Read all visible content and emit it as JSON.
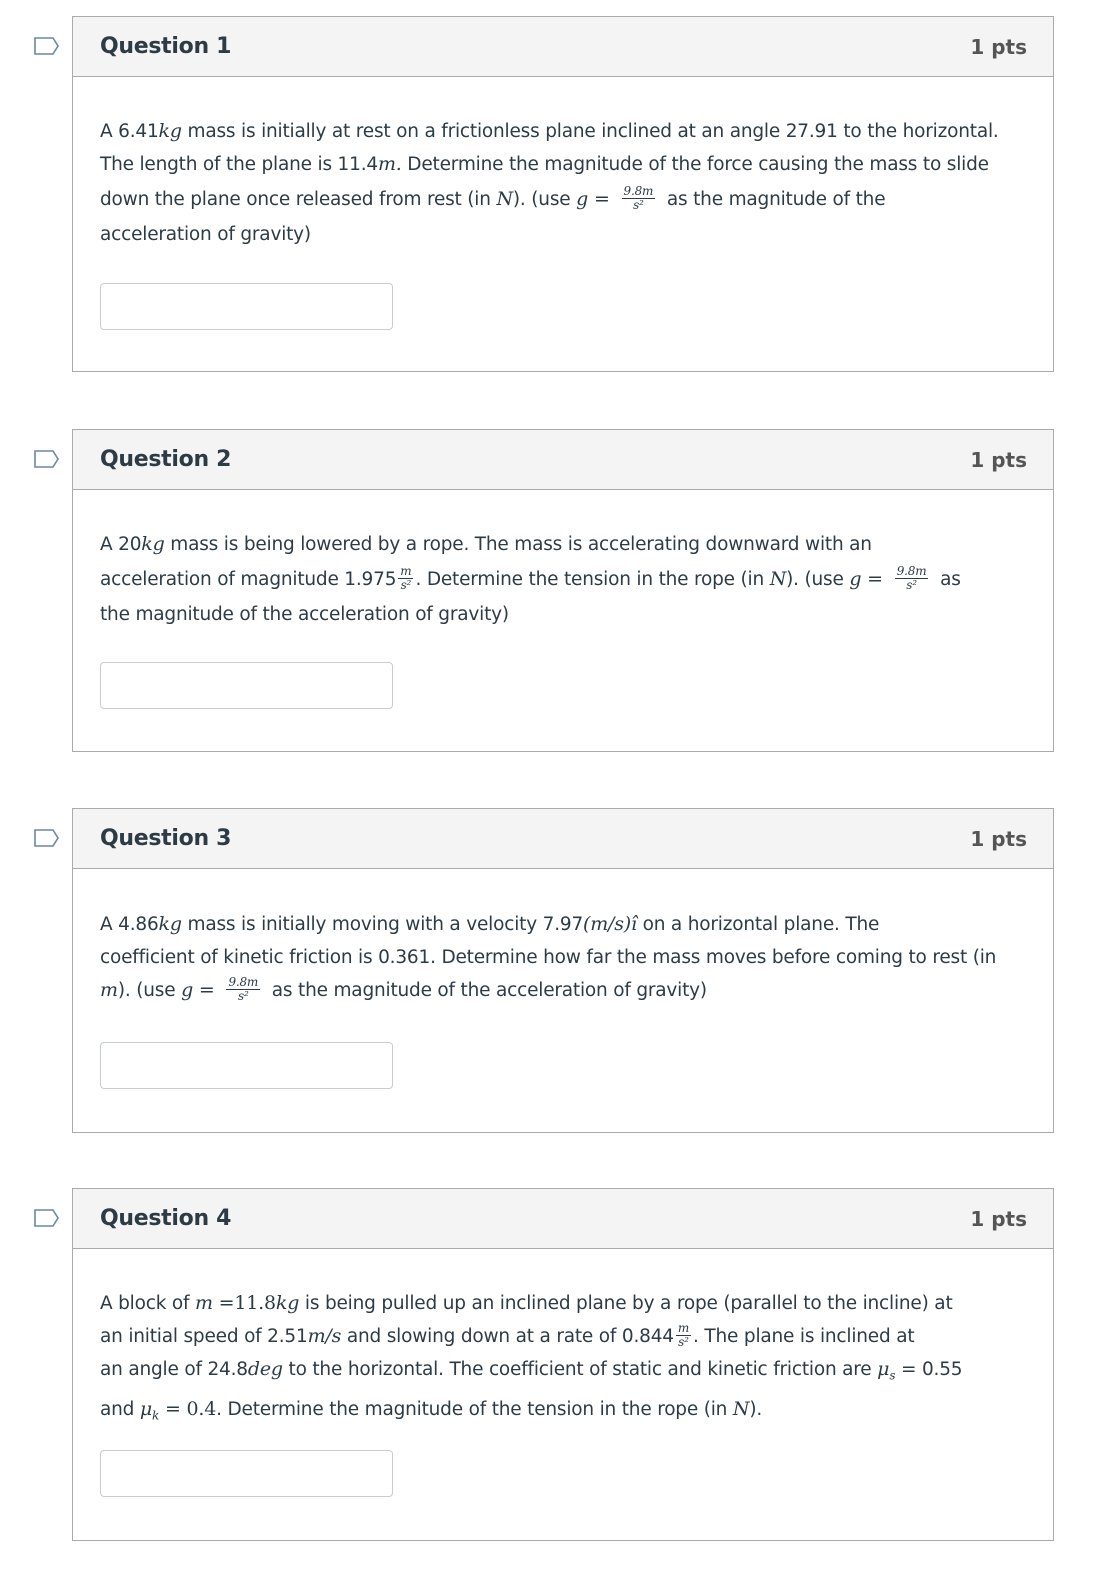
{
  "questions": [
    {
      "title": "Question 1",
      "points": "1 pts",
      "text": {
        "l1a": "A  6.41",
        "l1b": "kg",
        "l1c": " mass is initially at rest on a  frictionless plane inclined at an angle 27.91  to the horizontal.",
        "l2a": "The length of the plane is 11.4",
        "l2b": "m.",
        "l2c": "  Determine the magnitude of the force causing the mass to  slide",
        "l3a": "down  the plane once released  from rest  (in ",
        "l3b": "N",
        "l3c": ").  (use  ",
        "l3d": "g",
        "l3e": " = ",
        "frac_num": "9.8m",
        "frac_den": "s²",
        "l3f": " as the magnitude of the",
        "l4": "acceleration of gravity)"
      },
      "answer_value": ""
    },
    {
      "title": "Question 2",
      "points": "1 pts",
      "text": {
        "l1a": "A  20",
        "l1b": "kg",
        "l1c": " mass   is   being lowered by a rope.   The mass is accelerating downward with an",
        "l2a": "acceleration of magnitude 1.975",
        "unit_num": "m",
        "unit_den": "s²",
        "l2b": ".   Determine the tension in the rope (in ",
        "l2c": "N",
        "l2d": "). (use  ",
        "l2e": "g",
        "l2f": " = ",
        "frac_num": "9.8m",
        "frac_den": "s²",
        "l2g": " as",
        "l3": "the magnitude of the acceleration of gravity)"
      },
      "answer_value": ""
    },
    {
      "title": "Question 3",
      "points": "1 pts",
      "text": {
        "l1a": "A  4.86",
        "l1b": "kg",
        "l1c": " mass is initially moving with a velocity 7.97",
        "l1d": "(m/s)î",
        "l1e": " on a  horizontal  plane.  The",
        "l2": "coefficient of kinetic friction is 0.361.  Determine how far the mass moves before coming to  rest  (in",
        "l3a": "m",
        "l3b": ").  (use  ",
        "l3c": "g",
        "l3d": " = ",
        "frac_num": "9.8m",
        "frac_den": "s²",
        "l3e": " as the magnitude of the acceleration of gravity)"
      },
      "answer_value": ""
    },
    {
      "title": "Question 4",
      "points": "1 pts",
      "text": {
        "l1a": "A block of ",
        "l1b": "m",
        "l1c": " =11.8",
        "l1d": "kg",
        "l1e": " is being pulled up an inclined plane by a rope (parallel to the incline) at",
        "l2a": "an initial speed of 2.51",
        "l2b": "m/s",
        "l2c": " and slowing down at a rate of 0.844",
        "unit_num": "m",
        "unit_den": "s²",
        "l2d": ". The plane is inclined at",
        "l3a": "an angle of 24.8",
        "l3b": "deg",
        "l3c": " to the horizontal. The coefficient of static and kinetic friction are ",
        "l3d": "μ",
        "l3e": "s",
        "l3f": " = 0.55",
        "l4a": "and  ",
        "l4b": "μ",
        "l4c": "k",
        "l4d": " = 0.4",
        "l4e": ". Determine the magnitude of the tension in the rope (in ",
        "l4f": "N",
        "l4g": ")."
      },
      "answer_value": ""
    }
  ]
}
